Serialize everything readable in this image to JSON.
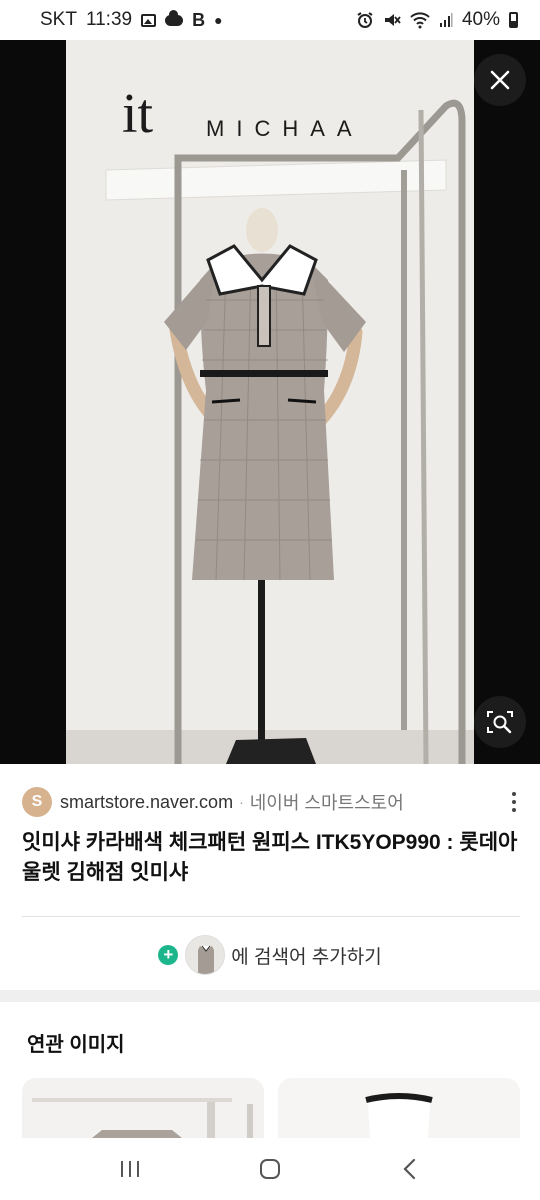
{
  "status_bar": {
    "carrier": "SKT",
    "time": "11:39",
    "b_label": "B",
    "battery": "40%"
  },
  "viewer": {
    "brand_logo_it": "it",
    "brand_logo_text": "MICHAA",
    "close_icon": "close-icon",
    "lens_icon": "image-search-icon"
  },
  "result": {
    "favicon_letter": "S",
    "domain": "smartstore.naver.com",
    "separator": "·",
    "site_name": "네이버 스마트스토어",
    "title": "잇미샤 카라배색 체크패턴 원피스 ITK5YOP990 : 롯데아울렛 김해점 잇미샤",
    "add_to_search": "에 검색어 추가하기"
  },
  "related": {
    "heading": "연관 이미지"
  },
  "colors": {
    "accent_green": "#1db68c",
    "favicon_bg": "#d7b28f"
  }
}
